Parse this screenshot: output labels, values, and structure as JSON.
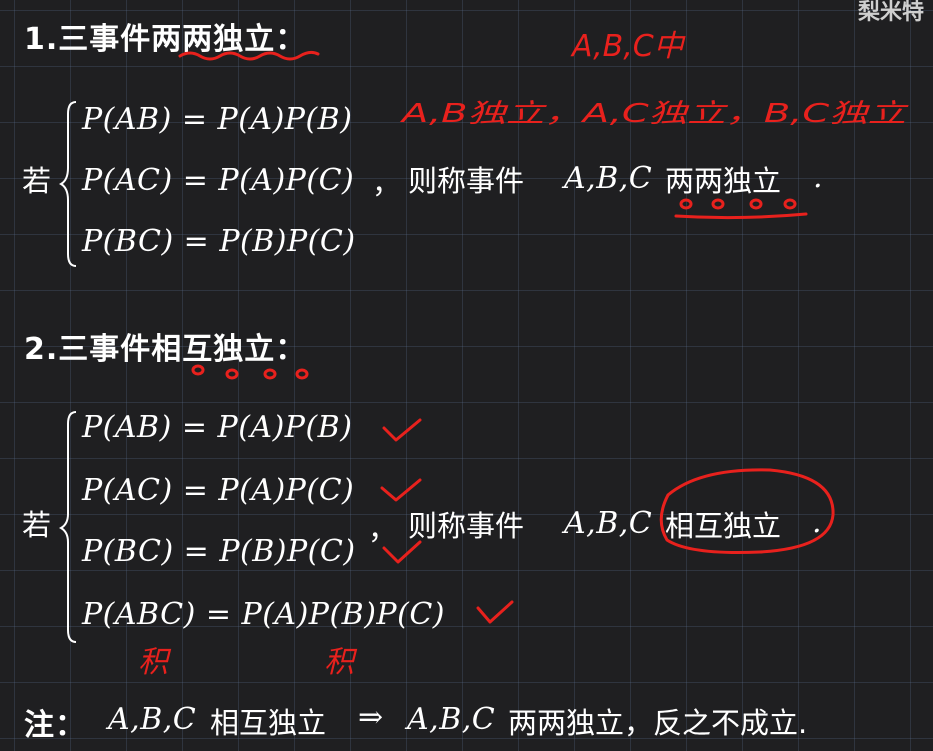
{
  "watermark": "梨米特",
  "section1": {
    "title": "1.三事件两两独立：",
    "ruo": "若",
    "equations": [
      "P(AB) = P(A)P(B)",
      "P(AC) = P(A)P(C)",
      "P(BC) = P(B)P(C)"
    ],
    "comma": "，",
    "then_text": "则称事件",
    "events": "A,B,C",
    "conclusion": "两两独立",
    "period": "."
  },
  "section2": {
    "title": "2.三事件相互独立：",
    "ruo": "若",
    "equations": [
      "P(AB) = P(A)P(B)",
      "P(AC) = P(A)P(C)",
      "P(BC) = P(B)P(C)",
      "P(ABC) = P(A)P(B)P(C)"
    ],
    "comma": "，",
    "then_text": "则称事件",
    "events": "A,B,C",
    "conclusion": "相互独立",
    "period": "."
  },
  "note": {
    "label": "注：",
    "events1": "A,B,C",
    "text1": "相互独立",
    "arrow": "⇒",
    "events2": "A,B,C",
    "text2": "两两独立，反之不成立."
  },
  "handwriting": {
    "top_note": "A,B,C中",
    "pairs_note": "A,B独立，A,C独立，B,C独立",
    "product_label": "积"
  },
  "colors": {
    "background": "#1f1f21",
    "text": "#ffffff",
    "annotation": "#e8211d",
    "grid": "#5a6e8c"
  }
}
